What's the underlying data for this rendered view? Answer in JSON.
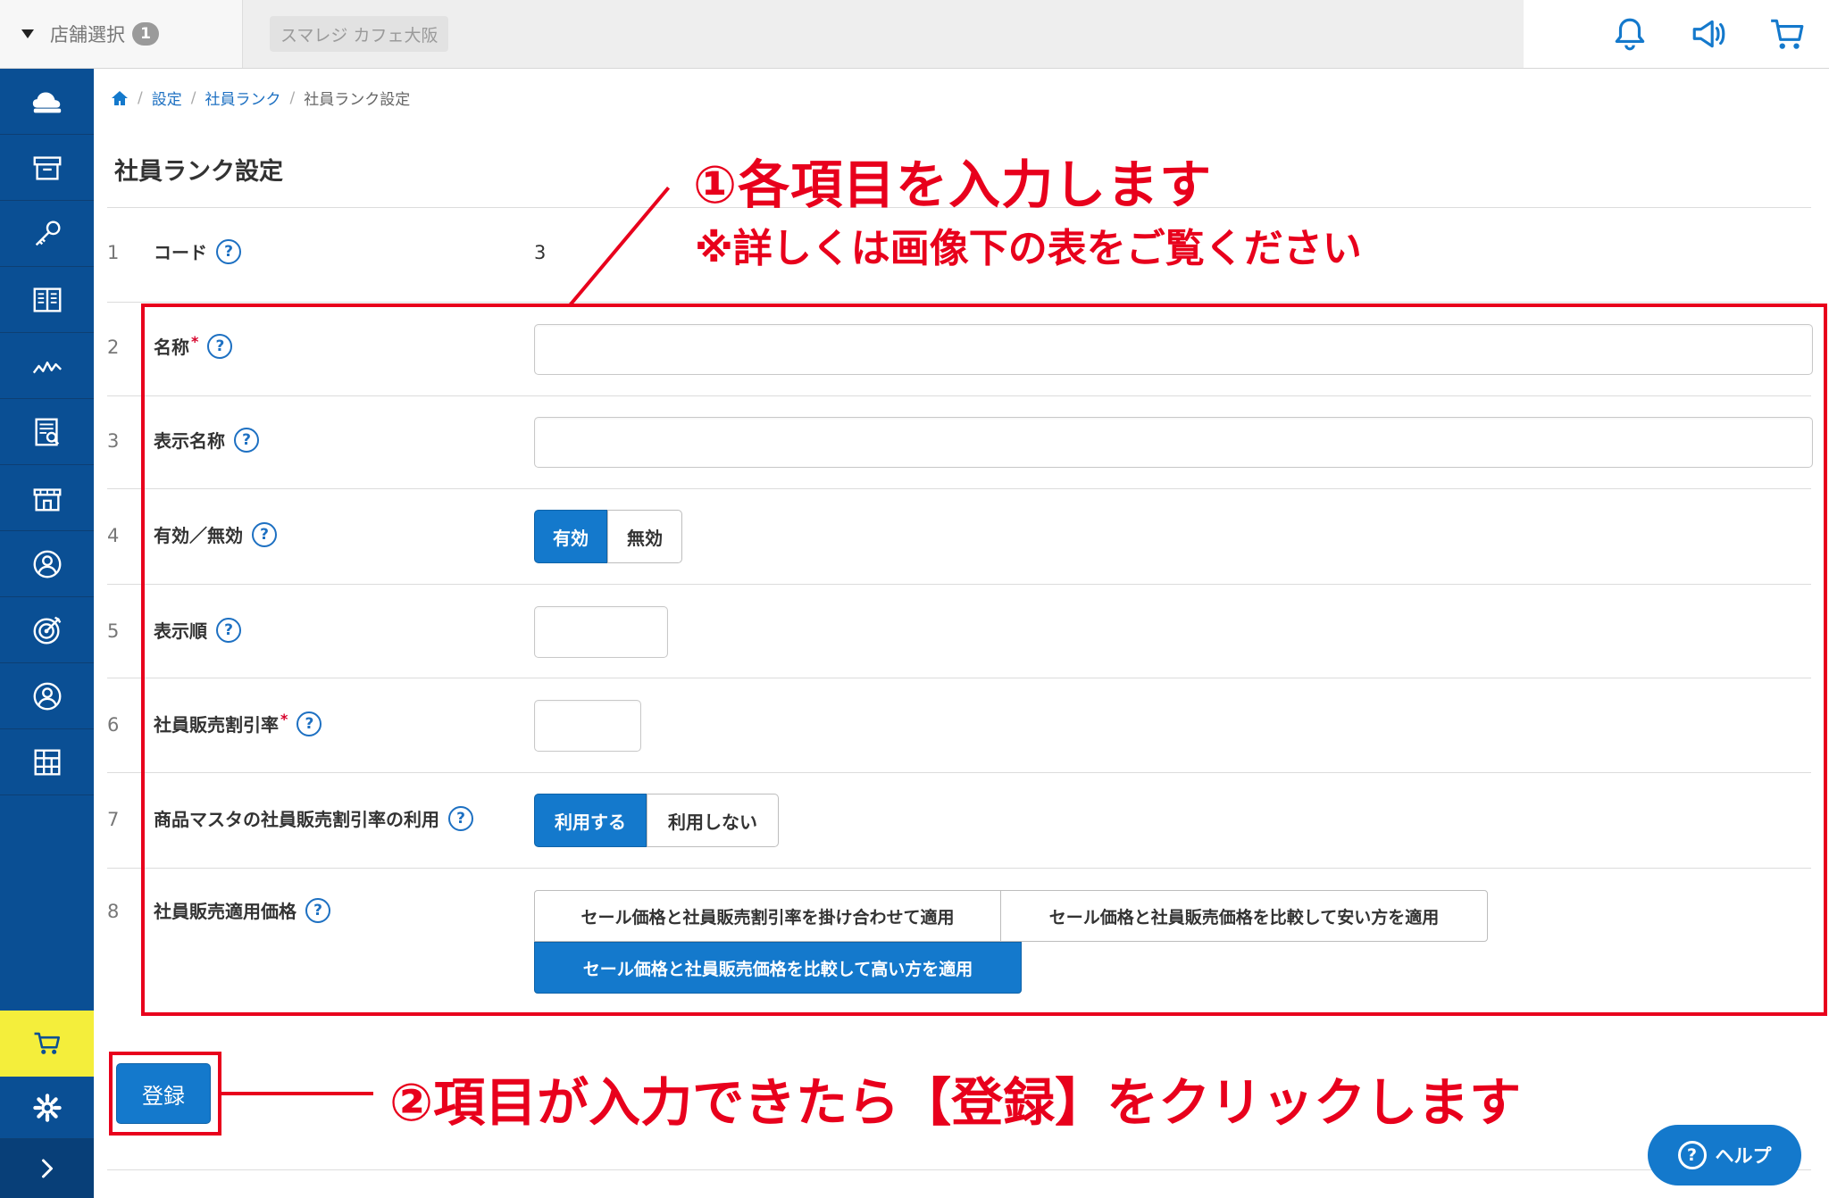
{
  "topbar": {
    "store_select_label": "店舗選択",
    "store_count": "1",
    "store_name": "スマレジ カフェ大阪"
  },
  "breadcrumb": {
    "home": "home-icon",
    "items": [
      "設定",
      "社員ランク"
    ],
    "current": "社員ランク設定",
    "separator": "/"
  },
  "page_title": "社員ランク設定",
  "form": {
    "rows": [
      {
        "num": "1",
        "label": "コード",
        "value": "3"
      },
      {
        "num": "2",
        "label": "名称",
        "required": "*"
      },
      {
        "num": "3",
        "label": "表示名称"
      },
      {
        "num": "4",
        "label": "有効／無効",
        "options": [
          "有効",
          "無効"
        ],
        "selected": "有効"
      },
      {
        "num": "5",
        "label": "表示順"
      },
      {
        "num": "6",
        "label": "社員販売割引率",
        "required": "*"
      },
      {
        "num": "7",
        "label": "商品マスタの社員販売割引率の利用",
        "options": [
          "利用する",
          "利用しない"
        ],
        "selected": "利用する"
      },
      {
        "num": "8",
        "label": "社員販売適用価格",
        "options": [
          "セール価格と社員販売割引率を掛け合わせて適用",
          "セール価格と社員販売価格を比較して安い方を適用",
          "セール価格と社員販売価格を比較して高い方を適用"
        ],
        "selected": "セール価格と社員販売価格を比較して高い方を適用"
      }
    ],
    "help_glyph": "?"
  },
  "submit_label": "登録",
  "help_button_label": "ヘルプ",
  "annotations": {
    "title": "①各項目を入力します",
    "subtitle": "※詳しくは画像下の表をご覧ください",
    "submit_note": "②項目が入力できたら【登録】をクリックします"
  },
  "colors": {
    "sidebar": "#0a4f94",
    "accent": "#1479cc",
    "annotation": "#e8001c",
    "cart_highlight": "#f4ee3b"
  }
}
